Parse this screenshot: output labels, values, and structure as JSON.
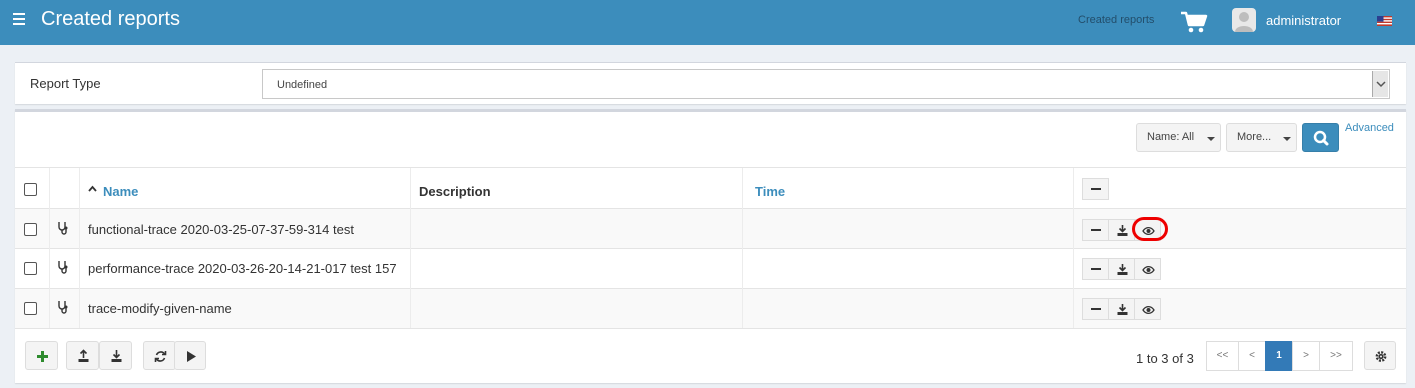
{
  "header": {
    "title": "Created reports",
    "breadcrumb": "Created reports",
    "user": "administrator"
  },
  "filter": {
    "label": "Report Type",
    "value": "Undefined"
  },
  "toolbar": {
    "name_filter": "Name: All",
    "more": "More...",
    "advanced": "Advanced"
  },
  "table": {
    "columns": {
      "name": "Name",
      "description": "Description",
      "time": "Time"
    },
    "rows": [
      {
        "name": "functional-trace 2020-03-25-07-37-59-314 test",
        "description": "",
        "time": ""
      },
      {
        "name": "performance-trace 2020-03-26-20-14-21-017 test 157",
        "description": "",
        "time": ""
      },
      {
        "name": "trace-modify-given-name",
        "description": "",
        "time": ""
      }
    ]
  },
  "pagination": {
    "summary": "1 to 3 of 3",
    "first": "<<",
    "prev": "<",
    "current": "1",
    "next": ">",
    "last": ">>"
  },
  "colors": {
    "header_bg": "#3c8dbc",
    "link": "#3c8dbc",
    "active_page": "#337ab7",
    "highlight": "#e00000"
  }
}
